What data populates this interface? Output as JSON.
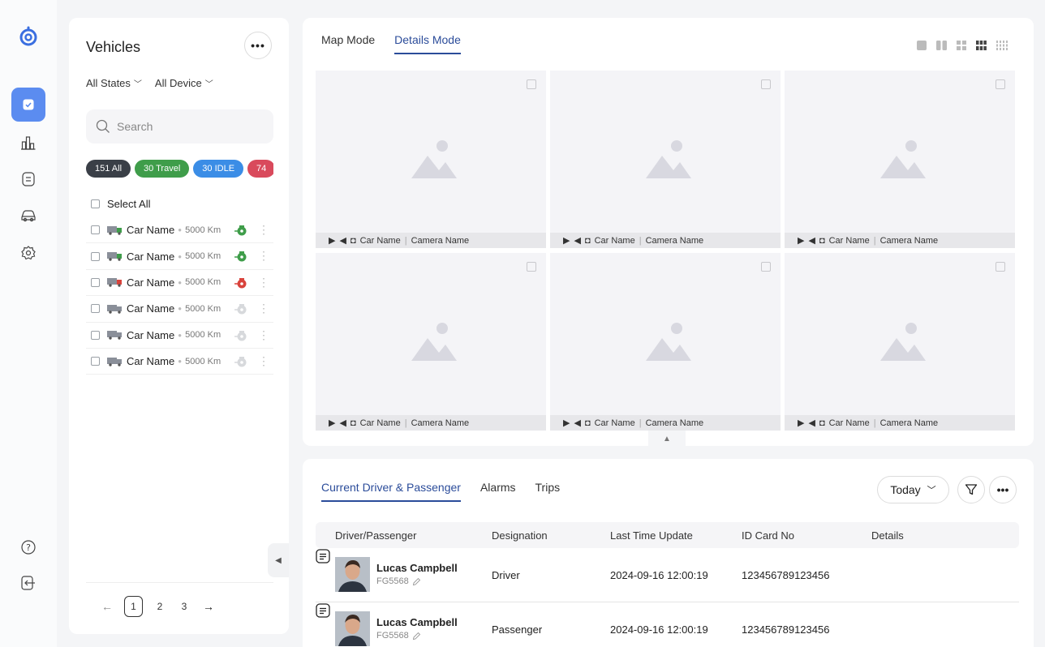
{
  "sidebar": {
    "icons": [
      "logo-icon",
      "dashboard-icon",
      "chart-icon",
      "document-icon",
      "car-icon",
      "settings-icon",
      "help-icon",
      "logout-icon"
    ],
    "active_color": "#5b8cf0"
  },
  "vehicles": {
    "title": "Vehicles",
    "filters": [
      "All States",
      "All Device"
    ],
    "search_placeholder": "Search",
    "chips": [
      {
        "label": "151 All",
        "color": "#3a3f47"
      },
      {
        "label": "30 Travel",
        "color": "#3f9d4a"
      },
      {
        "label": "30 IDLE",
        "color": "#3b8de6"
      },
      {
        "label": "74",
        "color": "#d94a5c"
      }
    ],
    "select_all": "Select All",
    "items": [
      {
        "name": "Car Name",
        "km": "5000 Km",
        "status": "travel"
      },
      {
        "name": "Car Name",
        "km": "5000 Km",
        "status": "travel"
      },
      {
        "name": "Car Name",
        "km": "5000 Km",
        "status": "alarm"
      },
      {
        "name": "Car Name",
        "km": "5000 Km",
        "status": "offline"
      },
      {
        "name": "Car Name",
        "km": "5000 Km",
        "status": "offline"
      },
      {
        "name": "Car Name",
        "km": "5000 Km",
        "status": "offline"
      }
    ],
    "pager": {
      "pages": [
        "1",
        "2",
        "3"
      ],
      "current": "1"
    }
  },
  "camera": {
    "tabs": [
      "Map Mode",
      "Details Mode"
    ],
    "active_tab": "Details Mode",
    "cells": [
      {
        "car": "Car Name",
        "camera": "Camera Name"
      },
      {
        "car": "Car Name",
        "camera": "Camera Name"
      },
      {
        "car": "Car Name",
        "camera": "Camera Name"
      },
      {
        "car": "Car Name",
        "camera": "Camera Name"
      },
      {
        "car": "Car Name",
        "camera": "Camera Name"
      },
      {
        "car": "Car Name",
        "camera": "Camera Name"
      }
    ]
  },
  "bottom": {
    "tabs": [
      "Current Driver & Passenger",
      "Alarms",
      "Trips"
    ],
    "active_tab": "Current Driver & Passenger",
    "date_filter": "Today",
    "columns": [
      "Driver/Passenger",
      "Designation",
      "Last Time Update",
      "ID Card No",
      "Details"
    ],
    "rows": [
      {
        "name": "Lucas Campbell",
        "code": "FG5568",
        "designation": "Driver",
        "updated": "2024-09-16 12:00:19",
        "id_card": "123456789123456"
      },
      {
        "name": "Lucas Campbell",
        "code": "FG5568",
        "designation": "Passenger",
        "updated": "2024-09-16 12:00:19",
        "id_card": "123456789123456"
      }
    ]
  }
}
